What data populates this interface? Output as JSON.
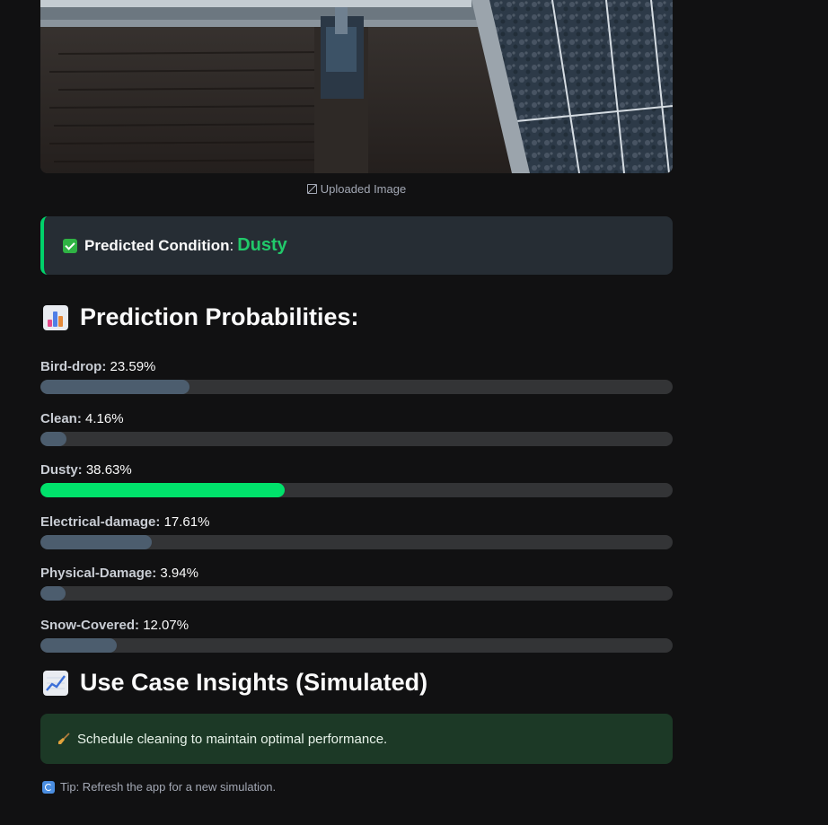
{
  "image": {
    "caption": "Uploaded Image",
    "caption_icon": "image-icon"
  },
  "result": {
    "label": "Predicted Condition",
    "colon": ":",
    "value": "Dusty",
    "icon": "check-mark-icon",
    "accent_color": "#00d26a"
  },
  "probabilities": {
    "heading": "Prediction Probabilities:",
    "heading_icon": "bar-chart-icon",
    "items": [
      {
        "name": "Bird-drop:",
        "percent_text": "23.59%",
        "value": 23.59,
        "active": false
      },
      {
        "name": "Clean:",
        "percent_text": "4.16%",
        "value": 4.16,
        "active": false
      },
      {
        "name": "Dusty:",
        "percent_text": "38.63%",
        "value": 38.63,
        "active": true
      },
      {
        "name": "Electrical-damage:",
        "percent_text": "17.61%",
        "value": 17.61,
        "active": false
      },
      {
        "name": "Physical-Damage:",
        "percent_text": "3.94%",
        "value": 3.94,
        "active": false
      },
      {
        "name": "Snow-Covered:",
        "percent_text": "12.07%",
        "value": 12.07,
        "active": false
      }
    ],
    "bar_color": "#4c5d6e",
    "active_color": "#00e26b"
  },
  "insights": {
    "heading": "Use Case Insights (Simulated)",
    "heading_icon": "chart-increasing-icon",
    "message": "Schedule cleaning to maintain optimal performance.",
    "message_icon": "broom-icon"
  },
  "tip": {
    "text": "Tip: Refresh the app for a new simulation.",
    "icon": "refresh-icon"
  }
}
